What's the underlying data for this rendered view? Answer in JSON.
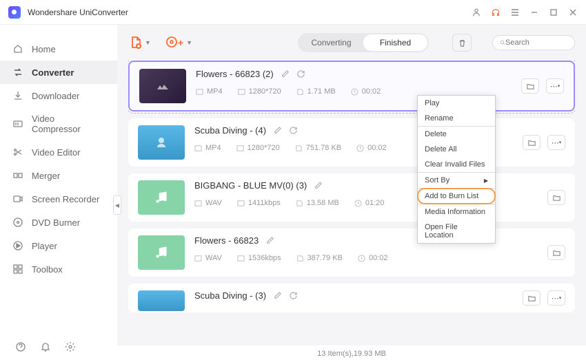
{
  "app": {
    "title": "Wondershare UniConverter"
  },
  "sidebar": {
    "items": [
      {
        "label": "Home"
      },
      {
        "label": "Converter"
      },
      {
        "label": "Downloader"
      },
      {
        "label": "Video Compressor"
      },
      {
        "label": "Video Editor"
      },
      {
        "label": "Merger"
      },
      {
        "label": "Screen Recorder"
      },
      {
        "label": "DVD Burner"
      },
      {
        "label": "Player"
      },
      {
        "label": "Toolbox"
      }
    ]
  },
  "tabs": {
    "converting": "Converting",
    "finished": "Finished"
  },
  "search": {
    "placeholder": "Search"
  },
  "files": [
    {
      "title": "Flowers - 66823 (2)",
      "format": "MP4",
      "resolution": "1280*720",
      "size": "1.71 MB",
      "duration": "00:02"
    },
    {
      "title": "Scuba Diving - (4)",
      "format": "MP4",
      "resolution": "1280*720",
      "size": "751.78 KB",
      "duration": "00:02"
    },
    {
      "title": "BIGBANG - BLUE MV(0) (3)",
      "format": "WAV",
      "resolution": "1411kbps",
      "size": "13.58 MB",
      "duration": "01:20"
    },
    {
      "title": "Flowers - 66823",
      "format": "WAV",
      "resolution": "1536kbps",
      "size": "387.79 KB",
      "duration": "00:02"
    },
    {
      "title": "Scuba Diving - (3)",
      "format": "",
      "resolution": "",
      "size": "",
      "duration": ""
    }
  ],
  "context_menu": {
    "play": "Play",
    "rename": "Rename",
    "delete": "Delete",
    "delete_all": "Delete All",
    "clear_invalid": "Clear Invalid Files",
    "sort_by": "Sort By",
    "add_burn": "Add to Burn List",
    "media_info": "Media Information",
    "open_location": "Open File Location"
  },
  "status": "13 Item(s),19.93 MB"
}
